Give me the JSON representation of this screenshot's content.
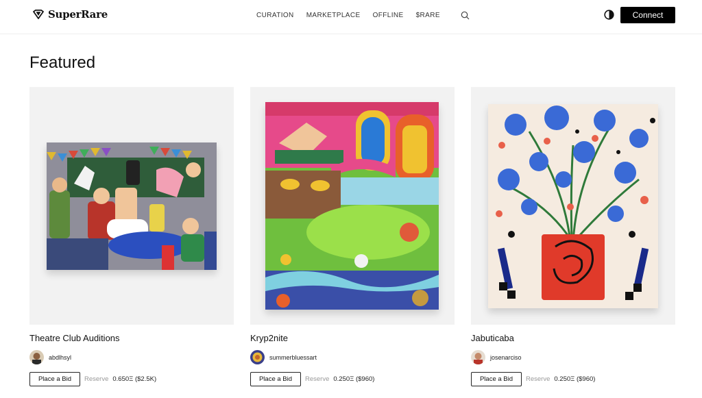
{
  "header": {
    "logo_text": "SuperRare",
    "logo_icon": "diamond-logo-icon",
    "nav": [
      "CURATION",
      "MARKETPLACE",
      "OFFLINE",
      "$RARE"
    ],
    "search_icon": "search-icon",
    "theme_icon": "contrast-icon",
    "connect_label": "Connect"
  },
  "main": {
    "section_title": "Featured",
    "cards": [
      {
        "title": "Theatre Club Auditions",
        "creator": "abdlhsyl",
        "bid_label": "Place a Bid",
        "reserve_label": "Reserve",
        "reserve_value": "0.650Ξ ($2.5K)"
      },
      {
        "title": "Kryp2nite",
        "creator": "summerbluessart",
        "bid_label": "Place a Bid",
        "reserve_label": "Reserve",
        "reserve_value": "0.250Ξ ($960)"
      },
      {
        "title": "Jabuticaba",
        "creator": "josenarciso",
        "bid_label": "Place a Bid",
        "reserve_label": "Reserve",
        "reserve_value": "0.250Ξ ($960)"
      }
    ]
  },
  "colors": {
    "accent": "#000000",
    "card_bg": "#f2f2f2",
    "muted_text": "#999999"
  }
}
